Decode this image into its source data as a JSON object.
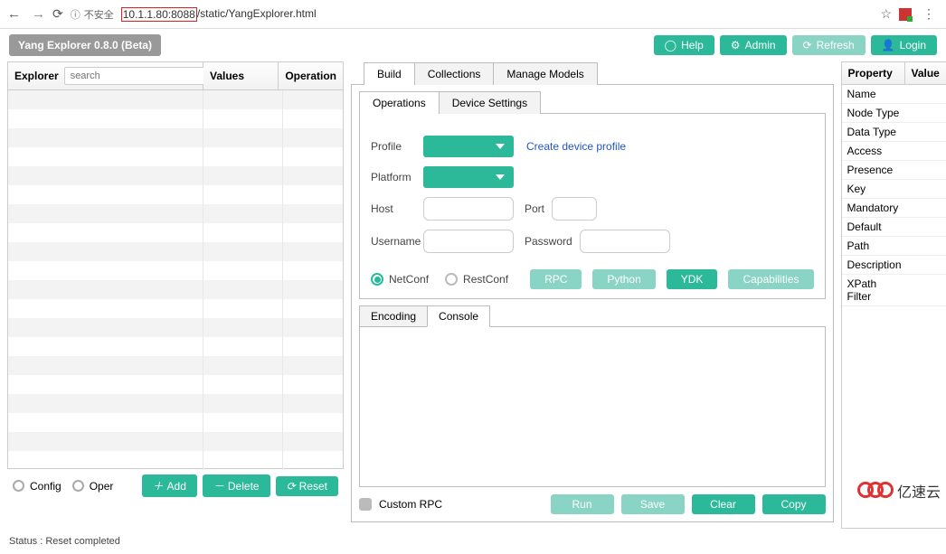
{
  "browser": {
    "insecure_label": "不安全",
    "url_highlighted": "10.1.1.80:8088",
    "url_rest": "/static/YangExplorer.html"
  },
  "brand": "Yang Explorer 0.8.0 (Beta)",
  "topbar": {
    "help": "Help",
    "admin": "Admin",
    "refresh": "Refresh",
    "login": "Login"
  },
  "left": {
    "explorer": "Explorer",
    "values": "Values",
    "operation": "Operation",
    "search_placeholder": "search",
    "config": "Config",
    "oper": "Oper",
    "add": "Add",
    "delete": "Delete",
    "reset": "Reset"
  },
  "center": {
    "tabs": {
      "build": "Build",
      "collections": "Collections",
      "manage": "Manage Models"
    },
    "subtabs": {
      "operations": "Operations",
      "device": "Device Settings"
    },
    "fields": {
      "profile": "Profile",
      "platform": "Platform",
      "host": "Host",
      "port": "Port",
      "username": "Username",
      "password": "Password"
    },
    "create_link": "Create device profile",
    "protocols": {
      "netconf": "NetConf",
      "restconf": "RestConf"
    },
    "actions": {
      "rpc": "RPC",
      "python": "Python",
      "ydk": "YDK",
      "caps": "Capabilities"
    },
    "console_tabs": {
      "encoding": "Encoding",
      "console": "Console"
    },
    "custom_rpc": "Custom RPC",
    "bottom": {
      "run": "Run",
      "save": "Save",
      "clear": "Clear",
      "copy": "Copy"
    }
  },
  "right": {
    "header": {
      "property": "Property",
      "value": "Value"
    },
    "rows": [
      "Name",
      "Node Type",
      "Data Type",
      "Access",
      "Presence",
      "Key",
      "Mandatory",
      "Default",
      "Path",
      "Description",
      "XPath Filter"
    ]
  },
  "status": "Status : Reset completed",
  "watermark": "亿速云"
}
